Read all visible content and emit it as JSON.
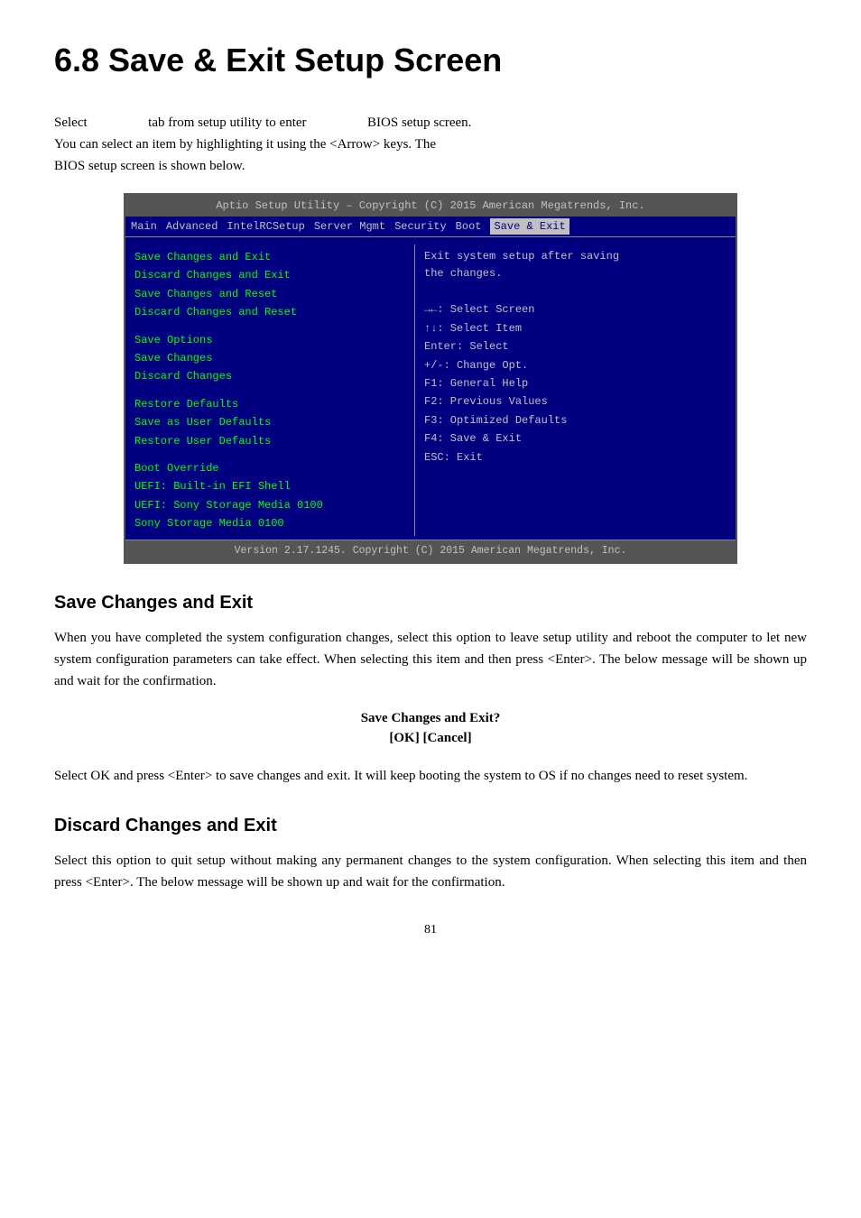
{
  "page": {
    "title": "6.8  Save & Exit Setup Screen",
    "intro1": "Select                          tab from setup utility to enter                          BIOS setup screen. You can select an item by highlighting it using the <Arrow> keys. The BIOS setup screen is shown below.",
    "bios": {
      "title_bar": "Aptio Setup Utility – Copyright (C) 2015 American Megatrends, Inc.",
      "nav_items": [
        "Main",
        "Advanced",
        "IntelRCSetup",
        "Server Mgmt",
        "Security",
        "Boot",
        "Save & Exit"
      ],
      "active_nav": "Save & Exit",
      "left_menu": {
        "group1": [
          "Save Changes and Exit",
          "Discard Changes and Exit",
          "Save Changes and Reset",
          "Discard Changes and Reset"
        ],
        "group2": [
          "Save Options",
          "Save Changes",
          "Discard Changes"
        ],
        "group3": [
          "Restore Defaults",
          "Save as User Defaults",
          "Restore User Defaults"
        ],
        "group4_header": "Boot Override",
        "group4": [
          "UEFI: Built-in EFI Shell",
          "UEFI: Sony Storage Media 0100",
          "Sony Storage Media 0100"
        ]
      },
      "right_help_text": "Exit system setup after saving the changes.",
      "key_help": [
        "→←: Select Screen",
        "↑↓: Select Item",
        "Enter: Select",
        "+/-: Change Opt.",
        "F1: General Help",
        "F2: Previous Values",
        "F3: Optimized Defaults",
        "F4: Save & Exit",
        "ESC: Exit"
      ],
      "footer": "Version 2.17.1245. Copyright (C) 2015 American Megatrends, Inc."
    },
    "section1": {
      "heading": "Save Changes and Exit",
      "body": "When you have completed the system configuration changes, select this option to leave setup utility and reboot the computer to let new system configuration parameters can take effect. When selecting this item and then press <Enter>. The below message will be shown up and wait for the confirmation.",
      "confirm_line1": "Save Changes and Exit?",
      "confirm_line2": "[OK] [Cancel]",
      "body2": "Select OK and press <Enter> to save changes and exit. It will keep booting the system to OS if no changes need to reset system."
    },
    "section2": {
      "heading": "Discard Changes and Exit",
      "body": "Select this option to quit setup without making any permanent changes to the system configuration. When selecting this item and then press <Enter>. The below message will be shown up and wait for the confirmation."
    },
    "page_number": "81"
  }
}
